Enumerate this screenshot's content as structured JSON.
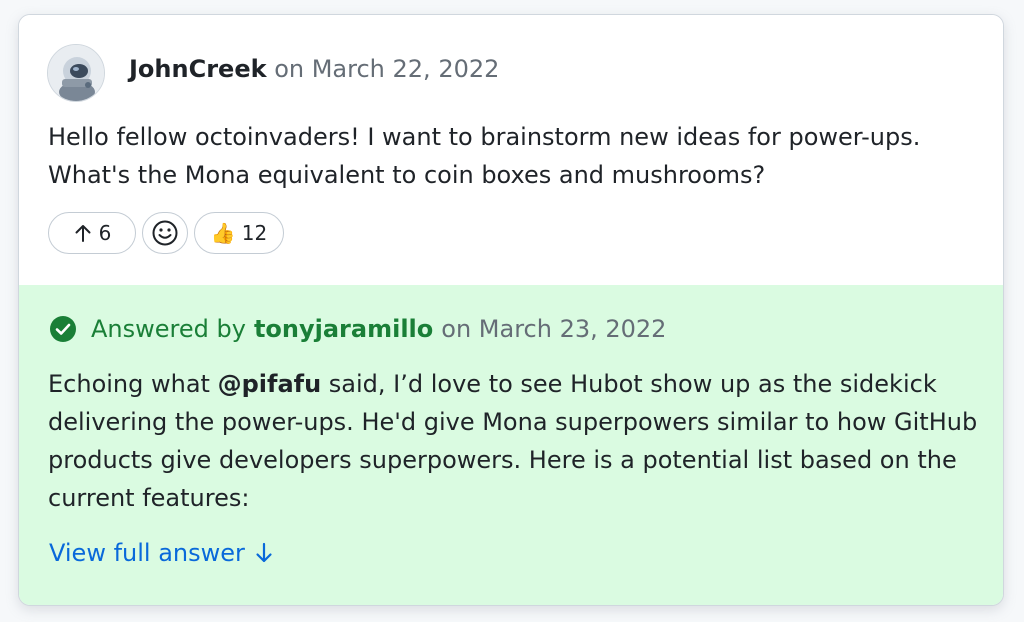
{
  "post": {
    "author": "JohnCreek",
    "date_prefix": "on March 22, 2022",
    "body": "Hello fellow octoinvaders! I want to brainstorm new ideas for power-ups. What's the Mona equivalent to coin boxes and mushrooms?"
  },
  "reactions": {
    "upvote_count": "6",
    "thumbs_count": "12",
    "thumbs_emoji": "👍",
    "add_reaction_icon": "smiley-icon",
    "upvote_icon": "arrow-up-icon"
  },
  "answer": {
    "label": "Answered by",
    "author": "tonyjaramillo",
    "date": "on March 23, 2022",
    "text_before": "Echoing what ",
    "mention": "@pifafu",
    "text_after": " said, I’d love to see Hubot show up as the sidekick delivering the power-ups. He'd give Mona superpowers similar to how GitHub products give developers superpowers. Here is a potential list based on the current features:",
    "view_full_label": "View full answer",
    "view_full_icon": "arrow-down-icon",
    "status_icon": "check-circle-icon"
  },
  "colors": {
    "answered_bg": "#dafbe1",
    "success": "#1a7f37",
    "link": "#0969da",
    "muted": "#656d76",
    "text": "#1f2328"
  }
}
